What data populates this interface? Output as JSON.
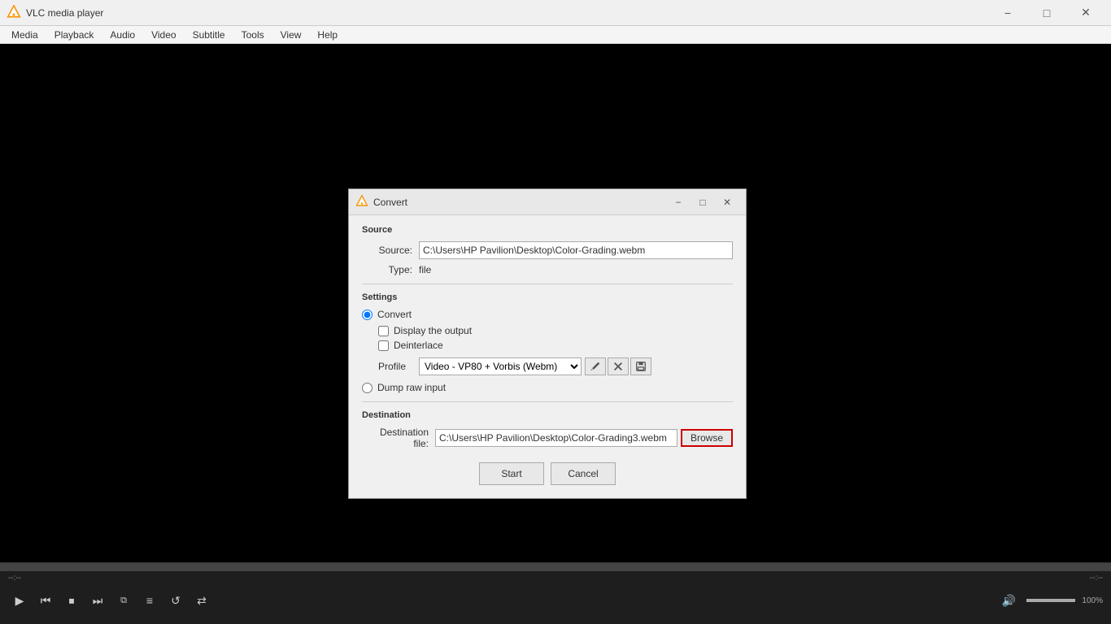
{
  "app": {
    "title": "VLC media player",
    "icon": "vlc-icon"
  },
  "menubar": {
    "items": [
      "Media",
      "Playback",
      "Audio",
      "Video",
      "Subtitle",
      "Tools",
      "View",
      "Help"
    ]
  },
  "dialog": {
    "title": "Convert",
    "source_section": "Source",
    "source_label": "Source:",
    "source_value": "C:\\Users\\HP Pavilion\\Desktop\\Color-Grading.webm",
    "type_label": "Type:",
    "type_value": "file",
    "settings_section": "Settings",
    "convert_label": "Convert",
    "display_output_label": "Display the output",
    "deinterlace_label": "Deinterlace",
    "profile_label": "Profile",
    "profile_value": "Video - VP80 + Vorbis (Webm)",
    "dump_raw_label": "Dump raw input",
    "destination_section": "Destination",
    "destination_file_label": "Destination file:",
    "destination_value": "C:\\Users\\HP Pavilion\\Desktop\\Color-Grading3.webm",
    "browse_label": "Browse",
    "start_label": "Start",
    "cancel_label": "Cancel"
  },
  "controls": {
    "time_left": "--:--",
    "time_right": "--:--",
    "volume_pct": "100%",
    "play_icon": "▶",
    "prev_icon": "⏮",
    "stop_icon": "⏹",
    "next_icon": "⏭",
    "frame_icon": "⧉",
    "extended_icon": "≡",
    "loop_icon": "↺",
    "shuffle_icon": "⇄",
    "volume_icon": "🔊"
  }
}
